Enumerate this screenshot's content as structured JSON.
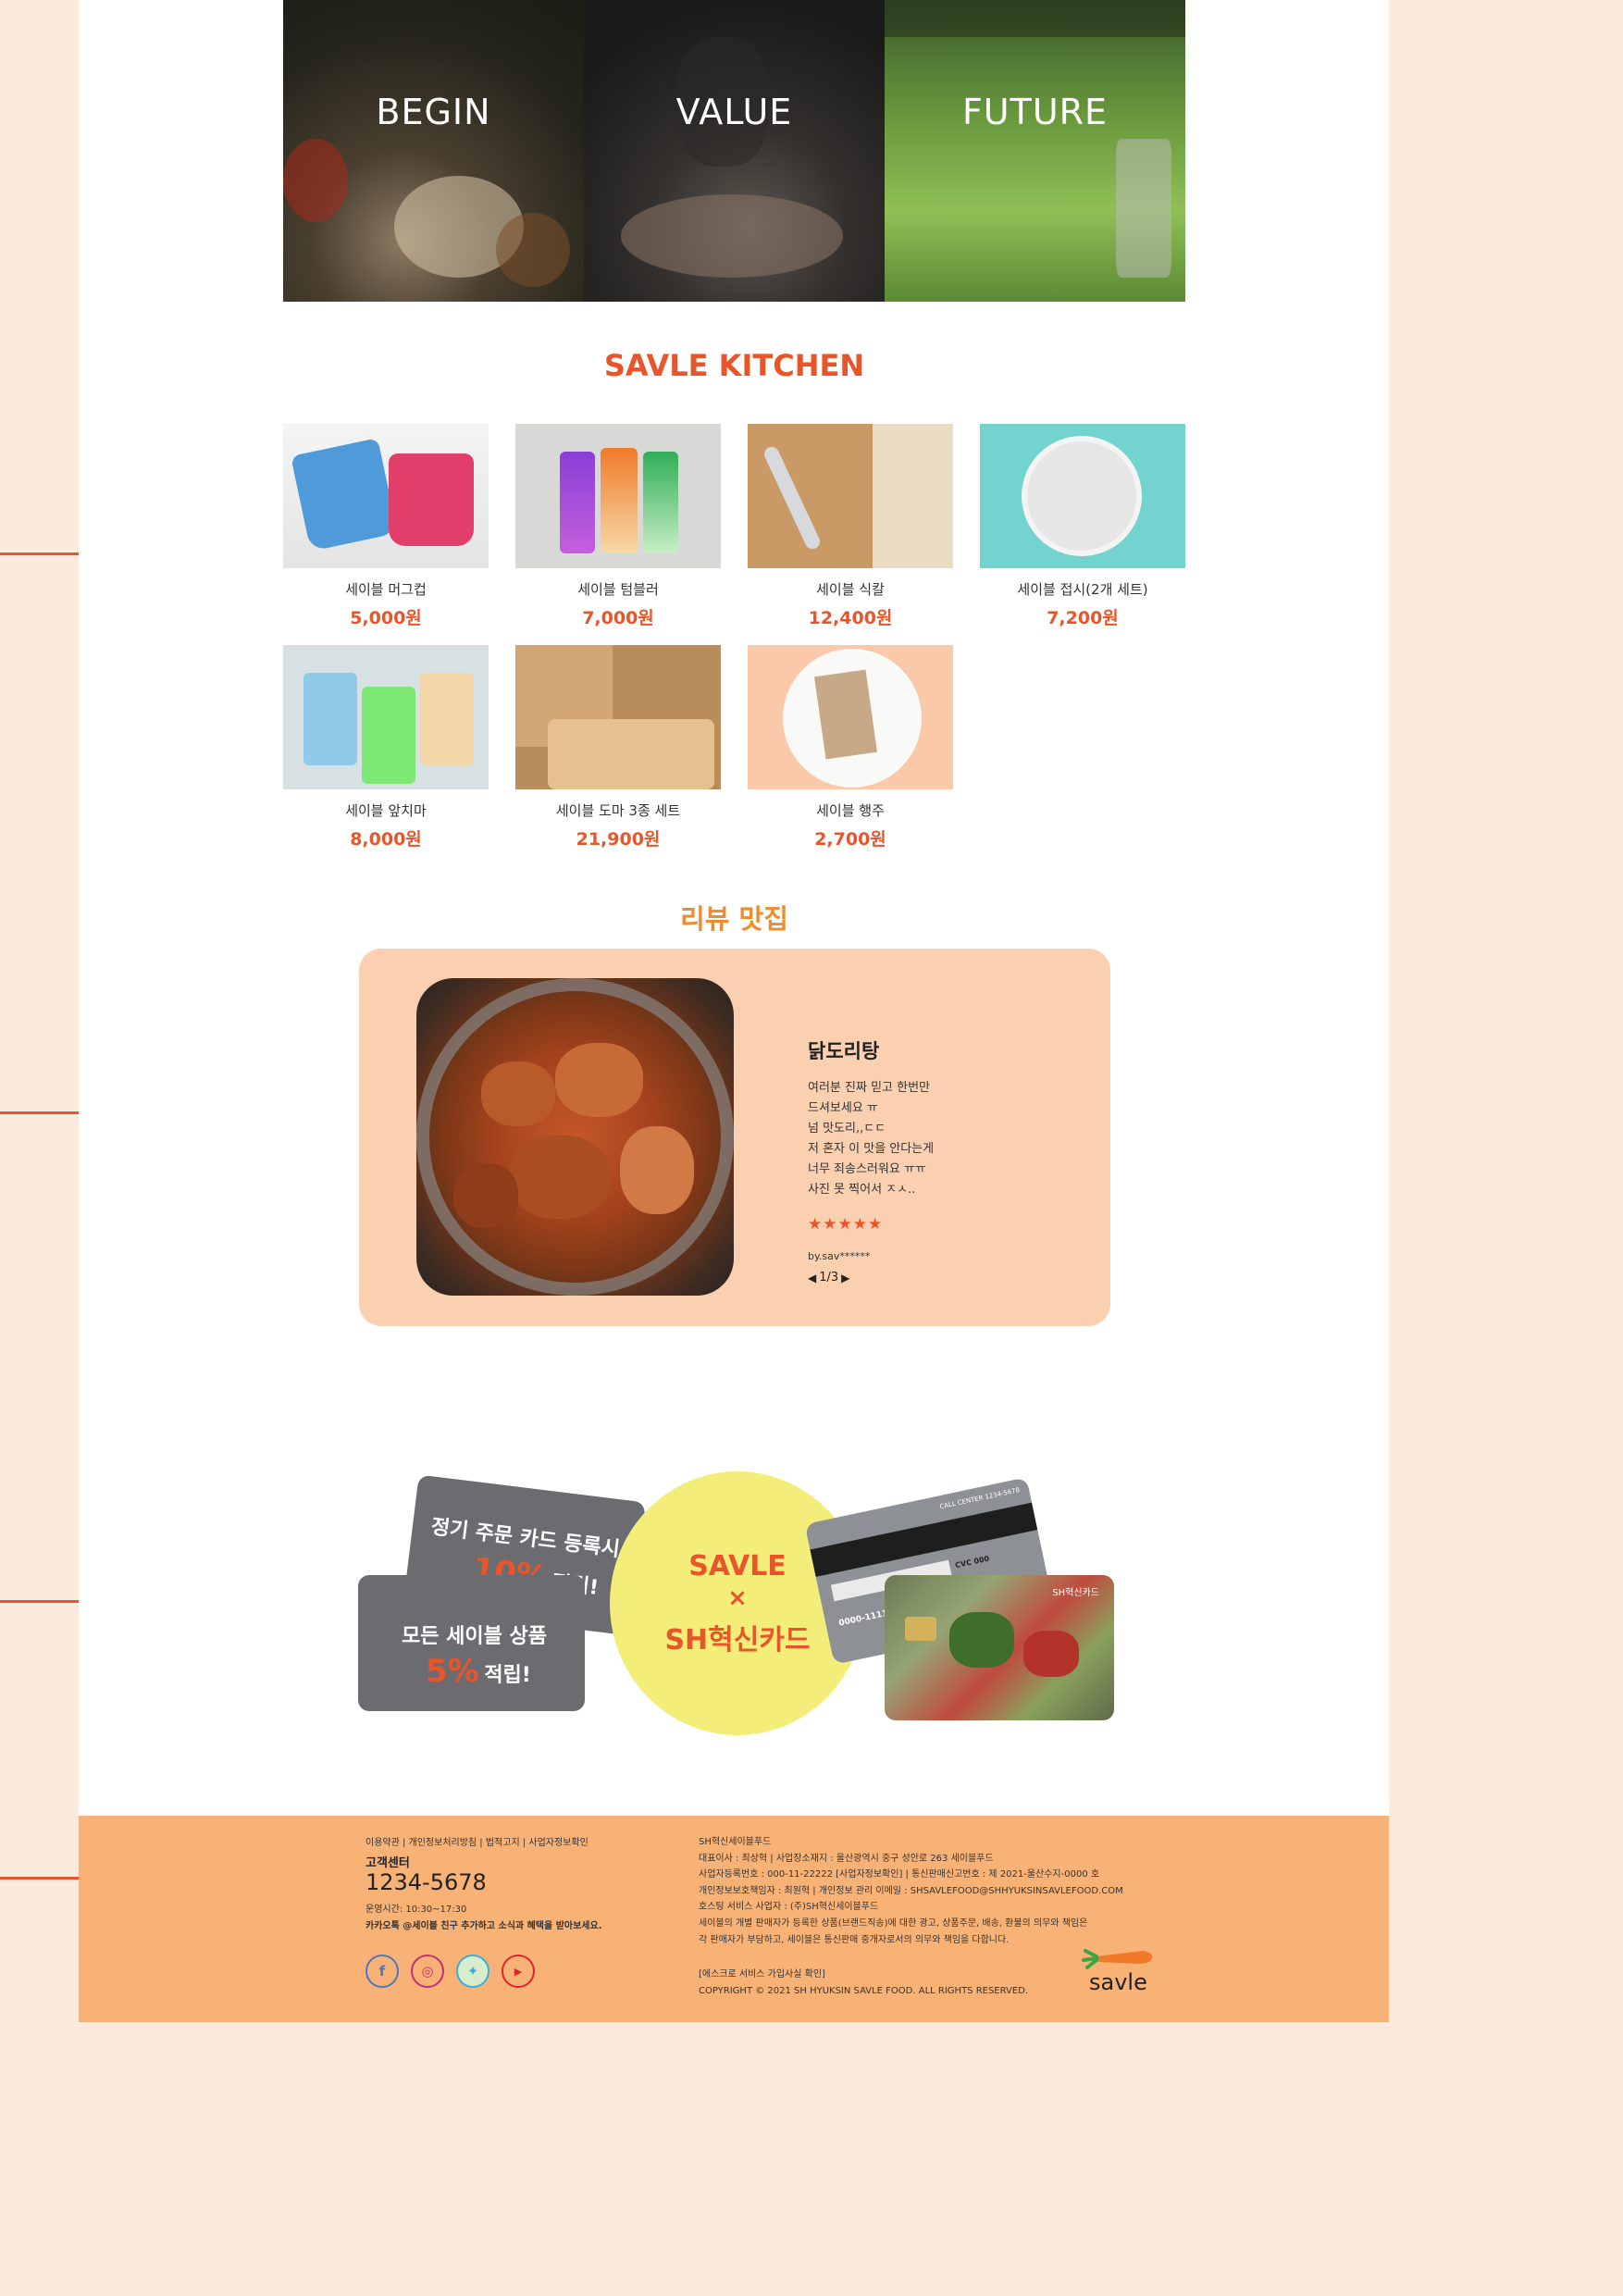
{
  "hero": {
    "panels": [
      {
        "label": "BEGIN"
      },
      {
        "label": "VALUE"
      },
      {
        "label": "FUTURE"
      }
    ]
  },
  "kitchen": {
    "title": "SAVLE KITCHEN",
    "products": [
      {
        "name": "세이블 머그컵",
        "price": "5,000원"
      },
      {
        "name": "세이블 텀블러",
        "price": "7,000원"
      },
      {
        "name": "세이블 식칼",
        "price": "12,400원"
      },
      {
        "name": "세이블 접시(2개 세트)",
        "price": "7,200원"
      },
      {
        "name": "세이블 앞치마",
        "price": "8,000원"
      },
      {
        "name": "세이블 도마 3종 세트",
        "price": "21,900원"
      },
      {
        "name": "세이블 행주",
        "price": "2,700원"
      }
    ]
  },
  "review": {
    "section_title": "리뷰 맛집",
    "dish": "닭도리탕",
    "lines": [
      "여러분 진짜 믿고 한번만",
      "드셔보세요 ㅠ",
      "넘 맛도리,,ㄷㄷ",
      "저 혼자 이 맛을 안다는게",
      "너무 죄송스러워요 ㅠㅠ",
      "사진 못 찍어서 ㅈㅅ.."
    ],
    "stars": "★★★★★",
    "rating": 5,
    "author": "by.sav******",
    "pager": "1/3",
    "prev_icon": "◀",
    "next_icon": "▶"
  },
  "promo": {
    "tag1_line1": "정기 주문 카드 등록시",
    "tag1_big": "10%",
    "tag1_suffix": "적립!",
    "tag2_line1": "모든 세이블 상품",
    "tag2_big": "5%",
    "tag2_suffix": "적립!",
    "circle_line1": "SAVLE",
    "circle_line2": "×",
    "circle_line3": "SH혁신카드",
    "card_back_header": "CALL CENTER 1234-5678",
    "card_back_cvc": "CVC 000",
    "card_back_number": "0000-1111",
    "card_front_name": "SH혁신카드"
  },
  "footer": {
    "links": "이용약관 | 개인정보처리방침 | 법적고지 | 사업자정보확인",
    "cs_title": "고객센터",
    "phone": "1234-5678",
    "hours": "운영시간: 10:30~17:30",
    "kakao": "카카오톡 @세이블 친구 추가하고 소식과 혜택을 받아보세요.",
    "info_lines": [
      "SH혁신세이블푸드",
      "대표이사 : 최상혁 | 사업장소재지 : 울산광역시 중구 성안로 263 세이블푸드",
      "사업자등록번호 : 000-11-22222 [사업자정보확인] | 통신판매신고번호 : 제 2021-울산수지-0000 호",
      "개인정보보호책임자 : 최원혁 | 개인정보 관리 이메일 : SHSAVLEFOOD@SHHYUKSINSAVLEFOOD.COM",
      "호스팅 서비스 사업자 : (주)SH혁신세이블푸드",
      "세이블의 개별 판매자가 등록한 상품(브랜드직송)에 대한 광고, 상품주문, 배송, 환불의 의무와 책임은",
      "각 판매자가 부담하고, 세이블은 통신판매 중개자로서의 의무와 책임을 다합니다."
    ],
    "escrow": "[에스크로 서비스 가입사실 확인]",
    "copyright": "COPYRIGHT © 2021 SH HYUKSIN SAVLE FOOD. ALL RIGHTS RESERVED.",
    "logo_text": "savle",
    "social": [
      {
        "icon": "facebook-icon",
        "glyph": "f",
        "color": "#4a78c2"
      },
      {
        "icon": "instagram-icon",
        "glyph": "◎",
        "color": "#c2307a"
      },
      {
        "icon": "twitter-icon",
        "glyph": "✦",
        "color": "#36b0d8"
      },
      {
        "icon": "youtube-icon",
        "glyph": "▶",
        "color": "#e0242c"
      }
    ]
  },
  "colors": {
    "accent": "#e8552a",
    "footer_bg": "#f9b276",
    "review_bg": "#fbd0b0",
    "promo_circle": "#f3ee7a",
    "page_bg": "#fcebdc"
  }
}
